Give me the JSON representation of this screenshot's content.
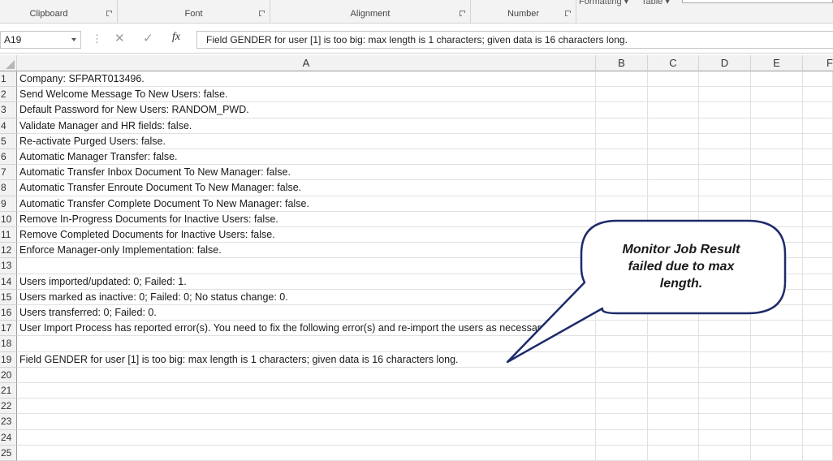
{
  "ribbon": {
    "groups": [
      {
        "label": "Clipboard"
      },
      {
        "label": "Font"
      },
      {
        "label": "Alignment"
      },
      {
        "label": "Number"
      }
    ],
    "top_labels": {
      "formatting": "Formatting ▾",
      "table": "Table ▾"
    }
  },
  "formula_bar": {
    "name_box": "A19",
    "cancel_icon": "✕",
    "enter_icon": "✓",
    "fx": "fx",
    "content": "Field GENDER for user [1] is too big: max length is 1 characters; given data is 16 characters long."
  },
  "columns": [
    "A",
    "B",
    "C",
    "D",
    "E",
    "F"
  ],
  "rows": [
    {
      "num": "1",
      "text": "Company: SFPART013496."
    },
    {
      "num": "2",
      "text": "Send Welcome Message To New Users: false."
    },
    {
      "num": "3",
      "text": "Default Password for New Users: RANDOM_PWD."
    },
    {
      "num": "4",
      "text": "Validate Manager and HR fields: false."
    },
    {
      "num": "5",
      "text": "Re-activate Purged Users: false."
    },
    {
      "num": "6",
      "text": "Automatic Manager Transfer: false."
    },
    {
      "num": "7",
      "text": "Automatic Transfer Inbox Document To New Manager: false."
    },
    {
      "num": "8",
      "text": "Automatic Transfer Enroute Document To New Manager: false."
    },
    {
      "num": "9",
      "text": "Automatic Transfer Complete Document To New Manager: false."
    },
    {
      "num": "10",
      "text": "Remove In-Progress Documents for Inactive Users: false."
    },
    {
      "num": "11",
      "text": "Remove Completed Documents for Inactive Users: false."
    },
    {
      "num": "12",
      "text": "Enforce Manager-only Implementation: false."
    },
    {
      "num": "13",
      "text": ""
    },
    {
      "num": "14",
      "text": "Users imported/updated: 0; Failed: 1."
    },
    {
      "num": "15",
      "text": "Users marked as inactive: 0; Failed: 0; No status change: 0."
    },
    {
      "num": "16",
      "text": "Users transferred: 0; Failed: 0."
    },
    {
      "num": "17",
      "text": "User Import Process has reported error(s).  You need to fix the following error(s) and re-import the users as necessary:"
    },
    {
      "num": "18",
      "text": ""
    },
    {
      "num": "19",
      "text": "Field GENDER for user [1] is too big: max length is 1 characters; given data is 16 characters long."
    },
    {
      "num": "20",
      "text": ""
    },
    {
      "num": "21",
      "text": ""
    },
    {
      "num": "22",
      "text": ""
    },
    {
      "num": "23",
      "text": ""
    },
    {
      "num": "24",
      "text": ""
    },
    {
      "num": "25",
      "text": ""
    }
  ],
  "callout": {
    "line1": "Monitor Job Result",
    "line2": "failed due to max",
    "line3": "length.",
    "fill": "#ffffff",
    "border": "#1f2a6b"
  }
}
